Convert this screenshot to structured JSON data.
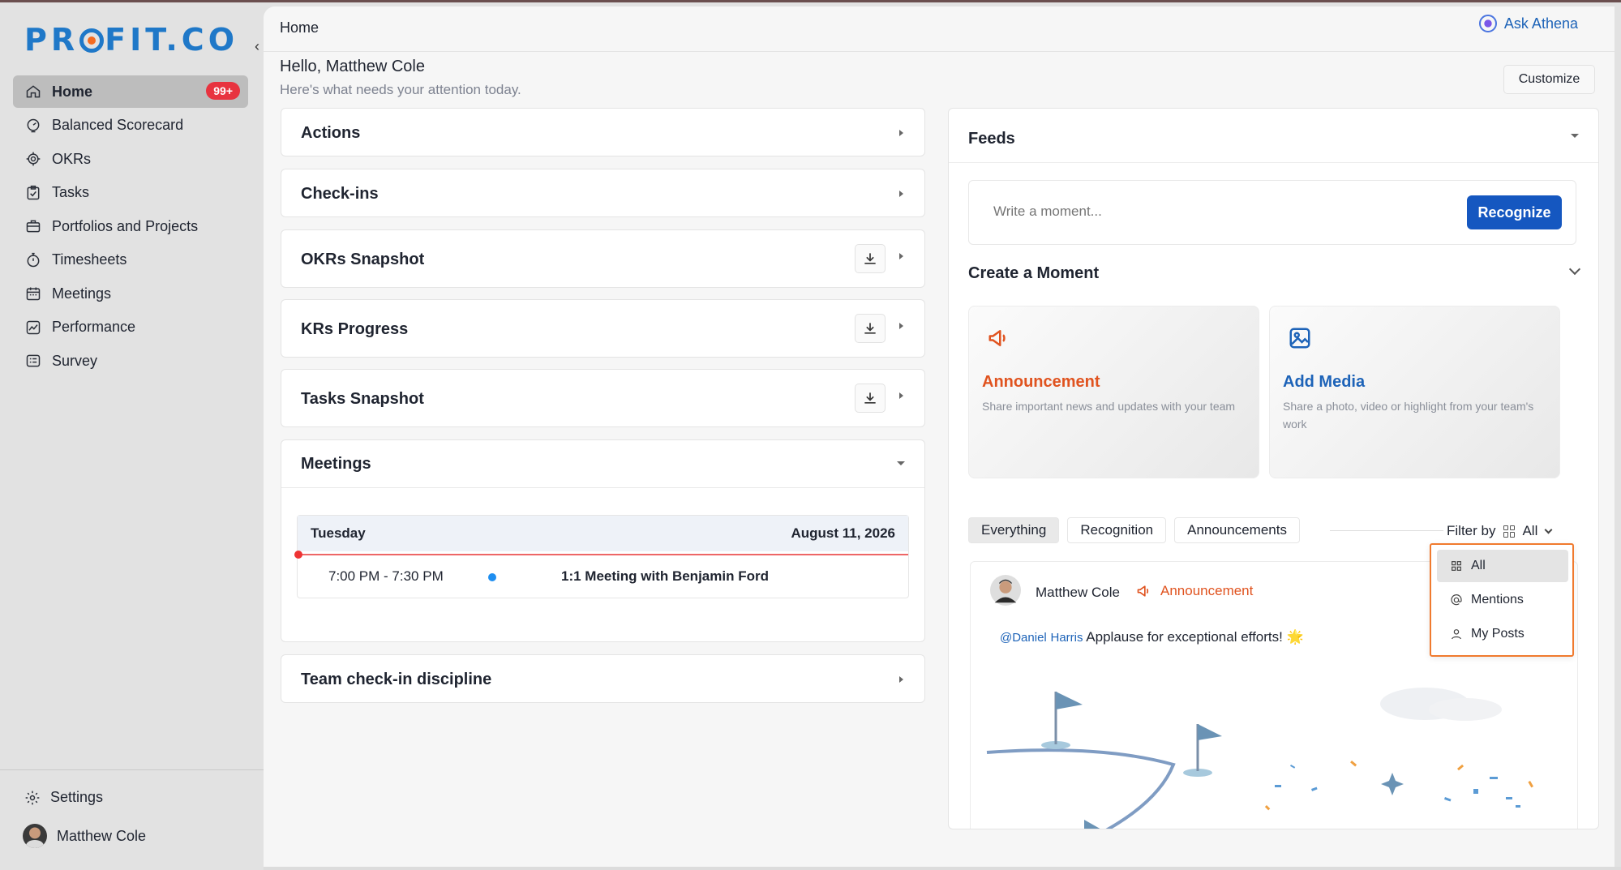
{
  "brand": {
    "logo_text_pre": "PR",
    "logo_text_post": "FIT.CO",
    "accent": "#1f78c8",
    "logo_dot": "#f36b21"
  },
  "sidebar": {
    "items": [
      {
        "label": "Home",
        "icon": "home-icon",
        "badge": "99+",
        "active": true
      },
      {
        "label": "Balanced Scorecard",
        "icon": "scorecard-icon"
      },
      {
        "label": "OKRs",
        "icon": "target-icon"
      },
      {
        "label": "Tasks",
        "icon": "clipboard-check-icon"
      },
      {
        "label": "Portfolios and Projects",
        "icon": "briefcase-icon"
      },
      {
        "label": "Timesheets",
        "icon": "stopwatch-icon"
      },
      {
        "label": "Meetings",
        "icon": "calendar-icon"
      },
      {
        "label": "Performance",
        "icon": "trend-chart-icon"
      },
      {
        "label": "Survey",
        "icon": "survey-icon"
      }
    ],
    "settings_label": "Settings",
    "user_name": "Matthew Cole"
  },
  "header": {
    "breadcrumb": "Home",
    "ask_label": "Ask Athena",
    "greeting": "Hello, Matthew Cole",
    "subtitle": "Here's what needs your attention today.",
    "customize_label": "Customize"
  },
  "cards": {
    "actions": "Actions",
    "checkins": "Check-ins",
    "okrs_snapshot": "OKRs Snapshot",
    "krs_progress": "KRs Progress",
    "tasks_snapshot": "Tasks Snapshot",
    "meetings": "Meetings",
    "team_checkin": "Team check-in discipline"
  },
  "meetings": {
    "day": "Tuesday",
    "date": "August 11, 2026",
    "rows": [
      {
        "time": "7:00 PM - 7:30 PM",
        "title": "1:1 Meeting with Benjamin Ford"
      }
    ]
  },
  "feeds": {
    "title": "Feeds",
    "moment_placeholder": "Write a moment...",
    "recognize_label": "Recognize",
    "create_title": "Create a Moment",
    "announcement": {
      "title": "Announcement",
      "desc": "Share important news and updates with your team",
      "color": "#e0531f"
    },
    "add_media": {
      "title": "Add Media",
      "desc": "Share a photo, video or highlight from your team's work",
      "color": "#1d63b8"
    },
    "tabs": [
      "Everything",
      "Recognition",
      "Announcements"
    ],
    "filter_label": "Filter by",
    "filter_value": "All",
    "filter_options": [
      "All",
      "Mentions",
      "My Posts"
    ],
    "post": {
      "author": "Matthew Cole",
      "type": "Announcement",
      "mention_first": "@Daniel",
      "mention_last": "Harris",
      "text": "Applause for exceptional efforts! 🌟"
    }
  }
}
